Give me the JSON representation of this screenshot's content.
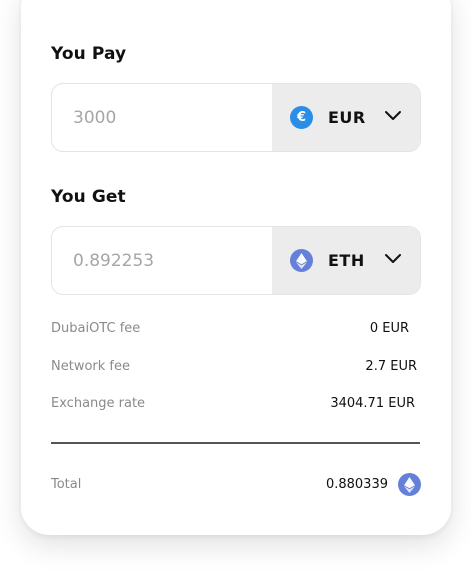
{
  "pay": {
    "title": "You Pay",
    "amount": "3000",
    "currency": {
      "code": "EUR",
      "icon": "euro-coin-icon",
      "icon_glyph": "€",
      "color": "#2a8de6"
    }
  },
  "get": {
    "title": "You Get",
    "amount": "0.892253",
    "currency": {
      "code": "ETH",
      "icon": "ethereum-coin-icon",
      "color": "#6480d8"
    }
  },
  "fees": [
    {
      "label": "DubaiOTC fee",
      "value": "0 EUR"
    },
    {
      "label": "Network fee",
      "value": "2.7 EUR"
    },
    {
      "label": "Exchange rate",
      "value": "3404.71 EUR"
    }
  ],
  "total": {
    "label": "Total",
    "value": "0.880339",
    "icon": "ethereum-coin-icon"
  },
  "colors": {
    "panel_bg": "#ececec",
    "border": "#e4e4e4",
    "muted_text": "#8a8a8a",
    "placeholder_text": "#a6a6a6",
    "divider": "#555555"
  }
}
